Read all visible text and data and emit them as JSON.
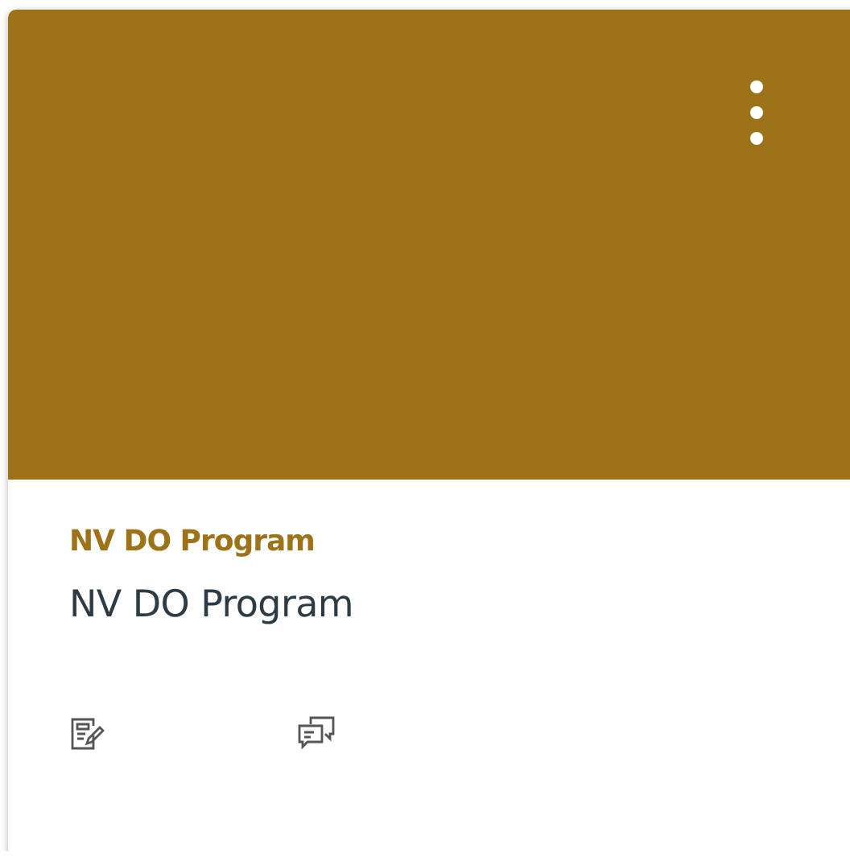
{
  "cards": [
    {
      "color": "#9e7218",
      "short_name": "NV DO Program",
      "name": "NV DO Program"
    }
  ]
}
